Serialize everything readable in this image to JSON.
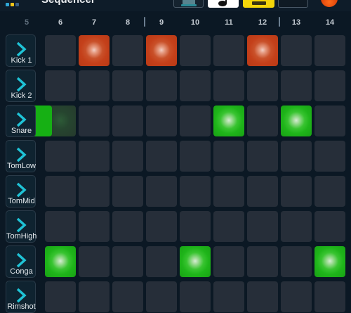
{
  "app": {
    "title": "Sequencer",
    "icon_name": "app-grid-icon",
    "toolbar": [
      {
        "name": "toolbar-button-1",
        "icon": "screen-icon"
      },
      {
        "name": "toolbar-button-2",
        "icon": "note-icon"
      },
      {
        "name": "toolbar-button-3",
        "icon": "active-mode-icon",
        "active": true,
        "color": "#f5d60a"
      },
      {
        "name": "toolbar-button-4",
        "icon": "blank-icon"
      }
    ],
    "record_button": {
      "icon": "record-icon",
      "color": "#e2460c"
    }
  },
  "colors": {
    "background": "#0b1824",
    "cell_off": "#262e39",
    "step_on_red": "#c9512a",
    "step_on_green": "#1fb51a",
    "accent_cyan": "#1fc3d6"
  },
  "steps": [
    "5",
    "6",
    "7",
    "8",
    "9",
    "10",
    "11",
    "12",
    "13",
    "14"
  ],
  "tracks": [
    {
      "label": "Kick 1",
      "color": "red",
      "pattern": [
        0,
        0,
        1,
        0,
        1,
        0,
        0,
        1,
        0,
        0
      ]
    },
    {
      "label": "Kick 2",
      "color": "red",
      "pattern": [
        0,
        0,
        0,
        0,
        0,
        0,
        0,
        0,
        0,
        0
      ]
    },
    {
      "label": "Snare",
      "color": "green",
      "pattern": [
        0,
        0,
        0,
        0,
        0,
        0,
        1,
        0,
        1,
        0
      ],
      "faded": [
        1
      ],
      "edge_on_left": true
    },
    {
      "label": "TomLow",
      "color": "green",
      "pattern": [
        0,
        0,
        0,
        0,
        0,
        0,
        0,
        0,
        0,
        0
      ]
    },
    {
      "label": "TomMid",
      "color": "green",
      "pattern": [
        0,
        0,
        0,
        0,
        0,
        0,
        0,
        0,
        0,
        0
      ]
    },
    {
      "label": "TomHigh",
      "color": "green",
      "pattern": [
        0,
        0,
        0,
        0,
        0,
        0,
        0,
        0,
        0,
        0
      ]
    },
    {
      "label": "Conga",
      "color": "green",
      "pattern": [
        0,
        1,
        0,
        0,
        0,
        1,
        0,
        0,
        0,
        1
      ]
    },
    {
      "label": "Rimshot",
      "color": "green",
      "pattern": [
        0,
        0,
        0,
        0,
        0,
        0,
        0,
        0,
        0,
        0
      ]
    }
  ]
}
